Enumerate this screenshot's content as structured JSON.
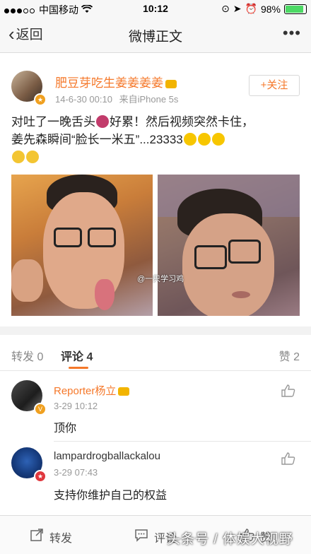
{
  "statusbar": {
    "carrier": "中国移动",
    "time": "10:12",
    "battery": "98%",
    "battery_level": 0.98
  },
  "navbar": {
    "back_label": "返回",
    "title": "微博正文",
    "more_label": "•••"
  },
  "post": {
    "author": "肥豆芽吃生姜姜姜姜",
    "timestamp": "14-6-30 00:10",
    "source": "来自iPhone 5s",
    "follow_label": "+关注",
    "text_line1": "对吐了一晚舌头",
    "text_line1b": "好累！然后视频突然卡住，",
    "text_line2": "姜先森瞬间“脸长一米五”...23333",
    "image_watermark": "@一只学习鸡"
  },
  "tabs": {
    "repost": "转发 0",
    "comment": "评论 4",
    "like": "赞 2"
  },
  "comments": [
    {
      "name": "Reporter杨立",
      "time": "3-29 10:12",
      "text": "顶你"
    },
    {
      "name": "lampardrogballackalou",
      "time": "3-29 07:43",
      "text": "支持你维护自己的权益"
    }
  ],
  "toolbar": {
    "repost_label": "转发",
    "comment_label": "评论",
    "like_label": "赞"
  },
  "overlay": {
    "brand": "头条号 / 体娱大视野"
  },
  "colors": {
    "accent": "#f5782a",
    "navbar_bg": "#f7f7f7"
  }
}
